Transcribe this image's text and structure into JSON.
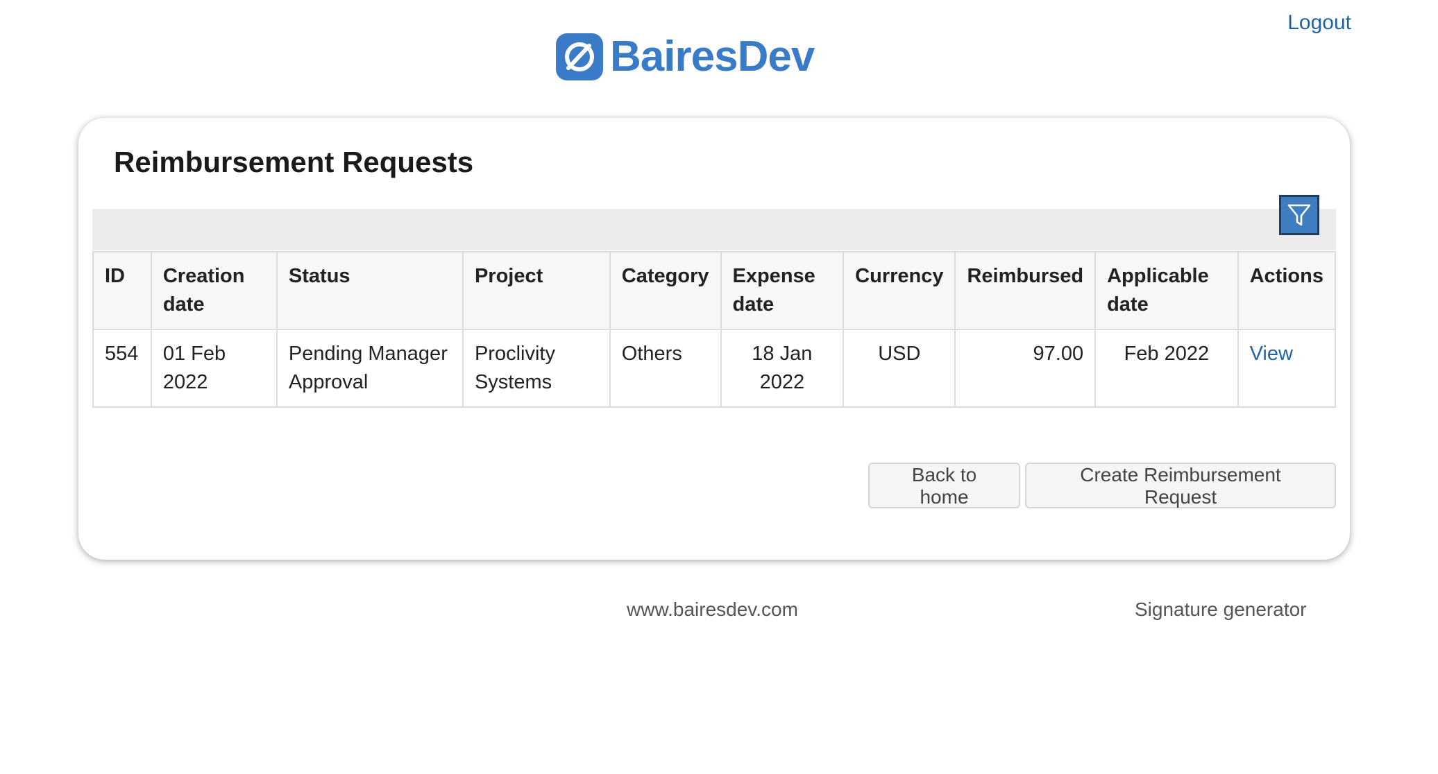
{
  "header": {
    "logo_text": "BairesDev",
    "logout_label": "Logout"
  },
  "card": {
    "title": "Reimbursement Requests",
    "filter_icon": "filter-icon"
  },
  "table": {
    "columns": [
      "ID",
      "Creation date",
      "Status",
      "Project",
      "Category",
      "Expense date",
      "Currency",
      "Reimbursed",
      "Applicable date",
      "Actions"
    ],
    "rows": [
      {
        "id": "554",
        "creation_date": "01 Feb 2022",
        "status": "Pending Manager Approval",
        "project": "Proclivity Systems",
        "category": "Others",
        "expense_date": "18 Jan 2022",
        "currency": "USD",
        "reimbursed": "97.00",
        "applicable_date": "Feb 2022",
        "action_label": "View"
      }
    ]
  },
  "buttons": {
    "back_label": "Back to home",
    "create_label": "Create Reimbursement Request"
  },
  "footer": {
    "site_link": "www.bairesdev.com",
    "signature_link": "Signature generator"
  },
  "colors": {
    "brand_blue": "#3a7bc8",
    "link_blue": "#1f63a8",
    "filter_bg": "#3f7dc1"
  }
}
